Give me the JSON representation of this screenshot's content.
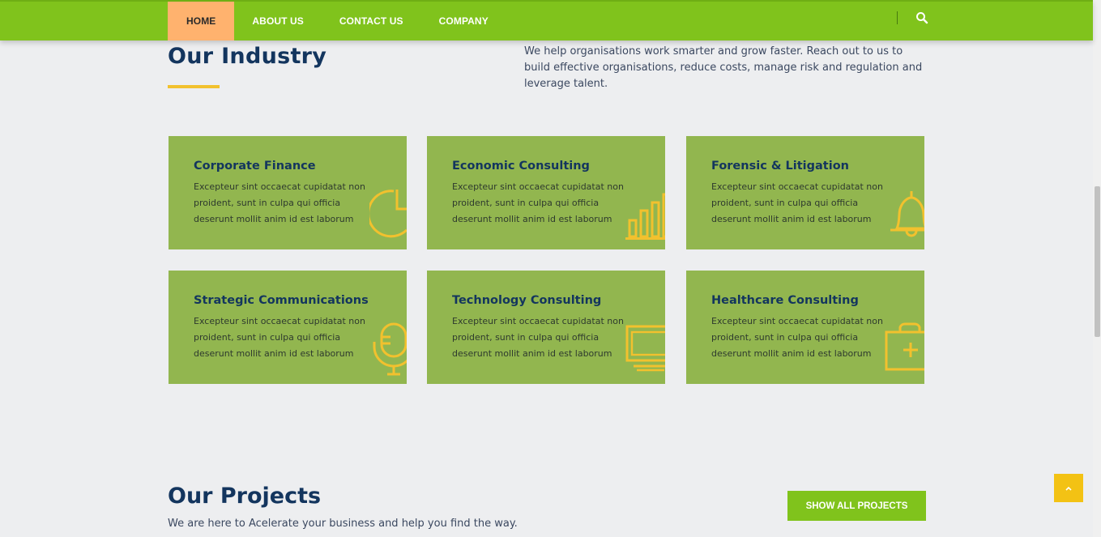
{
  "nav": {
    "items": [
      {
        "label": "HOME",
        "active": true
      },
      {
        "label": "ABOUT US",
        "active": false
      },
      {
        "label": "CONTACT US",
        "active": false
      },
      {
        "label": "COMPANY",
        "active": false
      }
    ],
    "search_icon": "search-icon"
  },
  "industry": {
    "title": "Our Industry",
    "description": "We help organisations work smarter and grow faster. Reach out to us to build effective organisations, reduce costs, manage risk and regulation and leverage talent.",
    "cards": [
      {
        "title": "Corporate Finance",
        "text": "Excepteur sint occaecat cupidatat non proident, sunt in culpa qui officia deserunt mollit anim id est laborum",
        "icon": "pie-chart-icon"
      },
      {
        "title": "Economic Consulting",
        "text": "Excepteur sint occaecat cupidatat non proident, sunt in culpa qui officia deserunt mollit anim id est laborum",
        "icon": "bar-chart-icon"
      },
      {
        "title": "Forensic & Litigation",
        "text": "Excepteur sint occaecat cupidatat non proident, sunt in culpa qui officia deserunt mollit anim id est laborum",
        "icon": "bell-icon"
      },
      {
        "title": "Strategic Communications",
        "text": "Excepteur sint occaecat cupidatat non proident, sunt in culpa qui officia deserunt mollit anim id est laborum",
        "icon": "microphone-icon"
      },
      {
        "title": "Technology Consulting",
        "text": "Excepteur sint occaecat cupidatat non proident, sunt in culpa qui officia deserunt mollit anim id est laborum",
        "icon": "monitor-icon"
      },
      {
        "title": "Healthcare Consulting",
        "text": "Excepteur sint occaecat cupidatat non proident, sunt in culpa qui officia deserunt mollit anim id est laborum",
        "icon": "medical-bag-icon"
      }
    ]
  },
  "projects": {
    "title": "Our Projects",
    "description": "We are here to Acelerate your business and help you find the way.",
    "button_label": "SHOW ALL PROJECTS"
  },
  "back_to_top_icon": "chevron-up-icon",
  "colors": {
    "nav_bg": "#80c31c",
    "active_nav_bg": "#ffb26e",
    "card_bg": "#92b64f",
    "heading": "#13355e",
    "accent": "#f2c12e"
  }
}
